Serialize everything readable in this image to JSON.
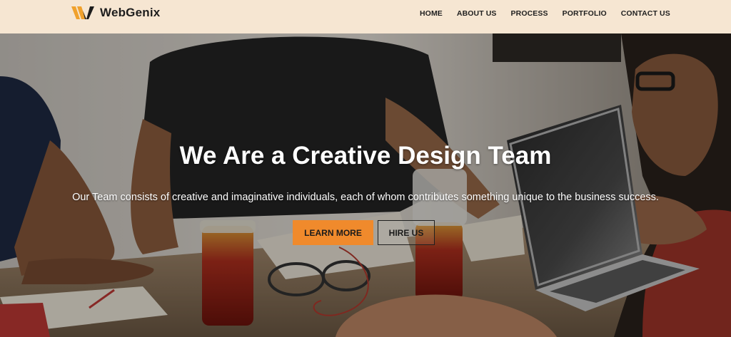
{
  "brand": {
    "name": "WebGenix",
    "logo_icon": "wg-logo-icon",
    "logo_colors": {
      "primary": "#f0a12c",
      "dark": "#1c1c1c"
    }
  },
  "nav": {
    "items": [
      {
        "label": "HOME"
      },
      {
        "label": "ABOUT US"
      },
      {
        "label": "PROCESS"
      },
      {
        "label": "PORTFOLIO"
      },
      {
        "label": "CONTACT US"
      }
    ]
  },
  "hero": {
    "title": "We Are a Creative Design Team",
    "subtitle": "Our Team consists of creative and imaginative individuals, each of whom contributes something unique to the business success.",
    "primary_button": "LEARN MORE",
    "secondary_button": "HIRE US",
    "background_image": "team-working-at-table-photo"
  },
  "colors": {
    "header_bg": "#f6e6d2",
    "accent": "#f08a2c",
    "text_dark": "#1f1f1f",
    "text_light": "#ffffff"
  }
}
